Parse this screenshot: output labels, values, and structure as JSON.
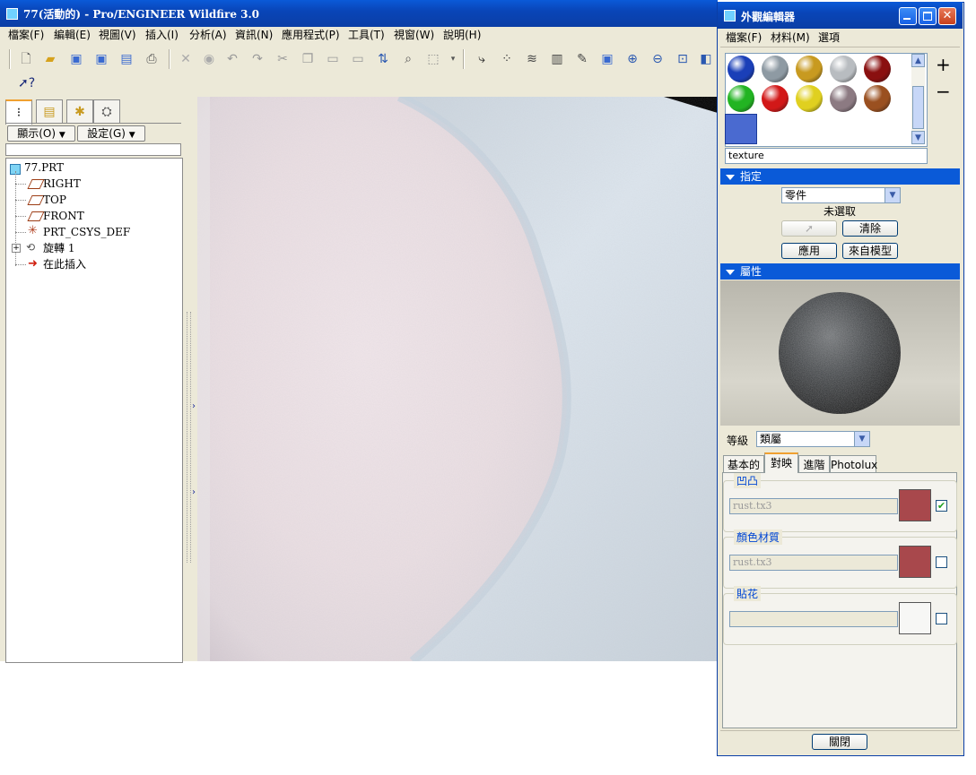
{
  "main": {
    "title": "77(活動的) - Pro/ENGINEER Wildfire 3.0",
    "menu": [
      "檔案(F)",
      "編輯(E)",
      "視圖(V)",
      "插入(I)",
      "分析(A)",
      "資訊(N)",
      "應用程式(P)",
      "工具(T)",
      "視窗(W)",
      "說明(H)"
    ]
  },
  "navigator": {
    "show_button": "顯示(O)",
    "settings_button": "設定(G)",
    "tree": [
      "77.PRT",
      "RIGHT",
      "TOP",
      "FRONT",
      "PRT_CSYS_DEF",
      "旋轉 1",
      "在此插入"
    ]
  },
  "appearance_editor": {
    "title": "外觀編輯器",
    "menu": [
      "檔案(F)",
      "材料(M)",
      "選項"
    ],
    "plus": "+",
    "minus": "−",
    "appearance_name": "texture",
    "assign_section": "指定",
    "assign_mode": "零件",
    "selection_status": "未選取",
    "clear_button": "清除",
    "apply_button": "應用",
    "from_model_button": "來自模型",
    "properties_section": "屬性",
    "class_label": "等級",
    "class_value": "類屬",
    "tabs": [
      "基本的",
      "對映",
      "進階",
      "Photolux"
    ],
    "bump_label": "凹凸",
    "bump_file": "rust.tx3",
    "bump_checked": true,
    "color_texture_label": "顏色材質",
    "color_texture_file": "rust.tx3",
    "decal_label": "貼花",
    "decal_file": "",
    "close_button": "關閉",
    "swatch_colors": [
      "#1a3fb8",
      "#8e9aa3",
      "#c89a20",
      "#b8bcc0",
      "#8a1010",
      "#22b422",
      "#d21818",
      "#e0d020",
      "#8c7a82",
      "#9a5020",
      "#6a7076"
    ]
  }
}
